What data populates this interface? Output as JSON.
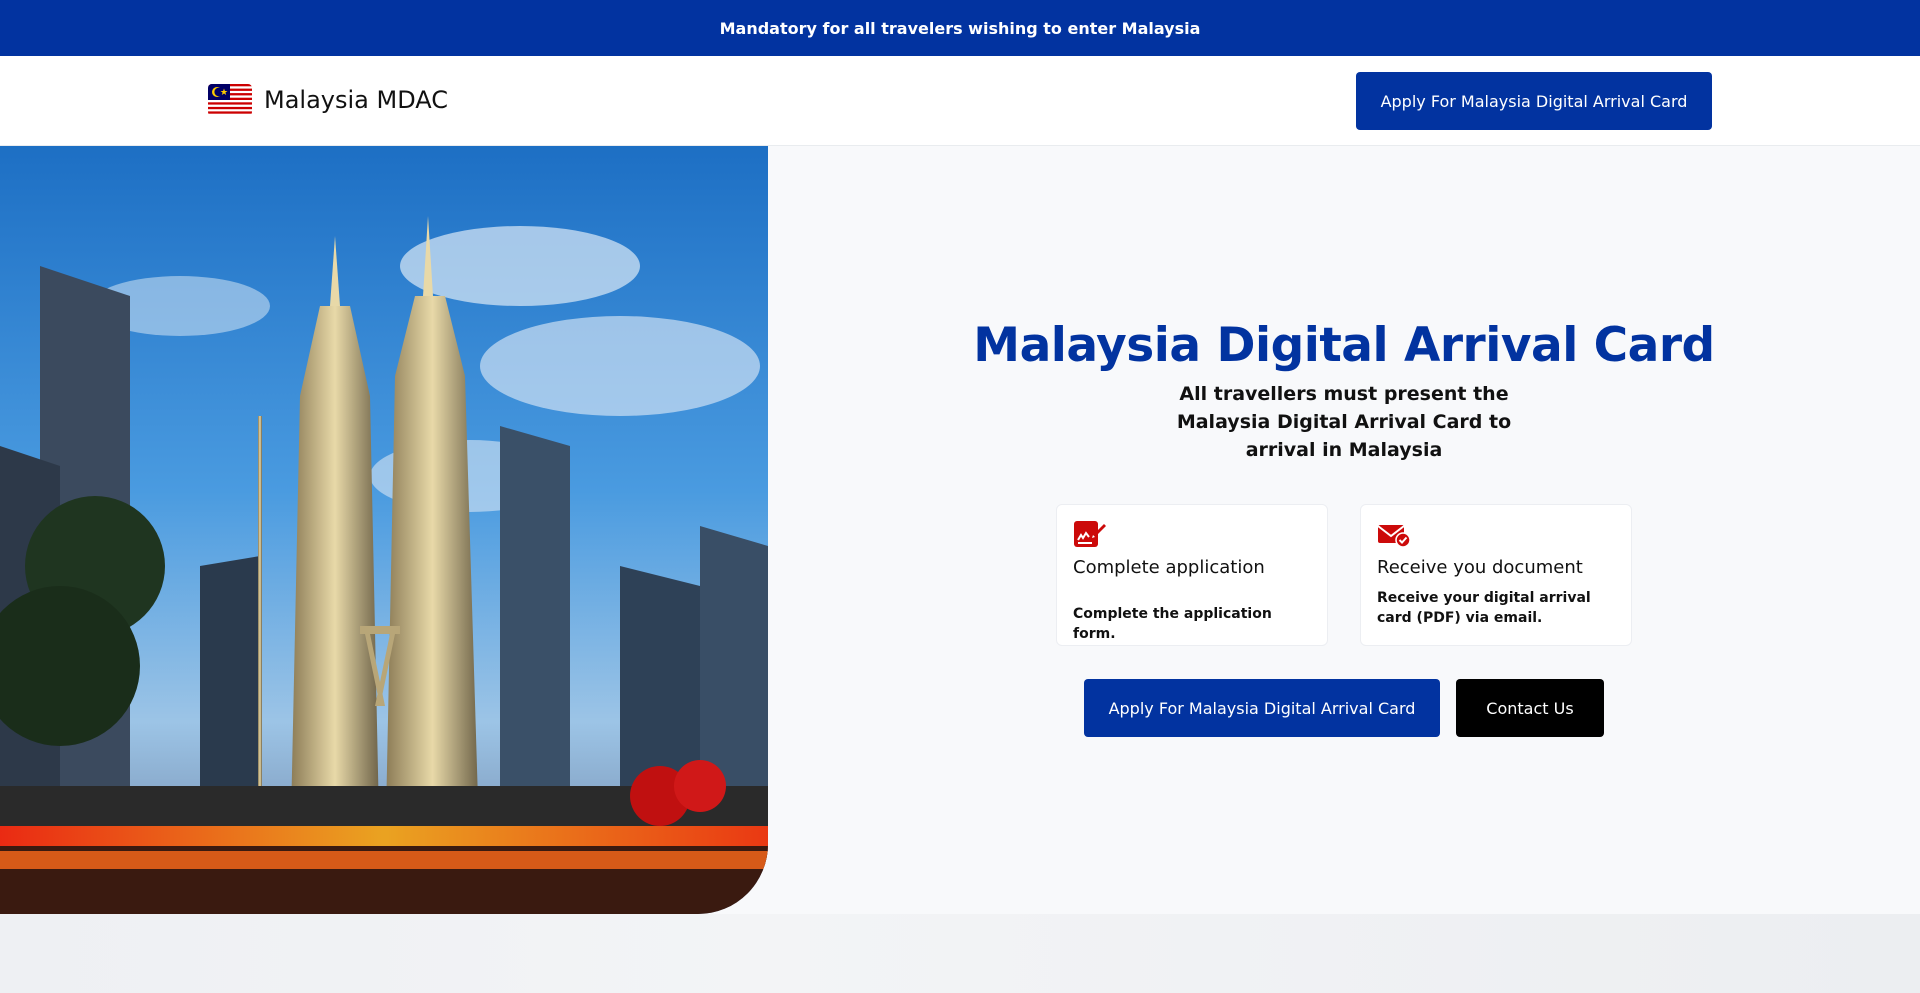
{
  "banner": {
    "text": "Mandatory for all travelers wishing to enter Malaysia"
  },
  "navbar": {
    "brand_text": "Malaysia MDAC",
    "flag_icon": "malaysia-flag-icon",
    "apply_label": "Apply For Malaysia Digital Arrival Card"
  },
  "hero": {
    "image_icon": "petronas-towers-photo",
    "title": "Malaysia Digital Arrival Card",
    "subtitle": "All travellers must present the Malaysia Digital Arrival Card to arrival in Malaysia",
    "steps": [
      {
        "icon": "signature-document-icon",
        "title": "Complete application",
        "description": "Complete the application form."
      },
      {
        "icon": "email-check-icon",
        "title": "Receive you document",
        "description": "Receive your digital arrival card (PDF) via email."
      }
    ],
    "apply_label": "Apply For Malaysia Digital Arrival Card",
    "contact_label": "Contact Us"
  },
  "colors": {
    "primary": "#0233a0",
    "accent_red": "#cc0a0a",
    "contact_bg": "#000000",
    "hero_bg": "#f8f9fb"
  }
}
